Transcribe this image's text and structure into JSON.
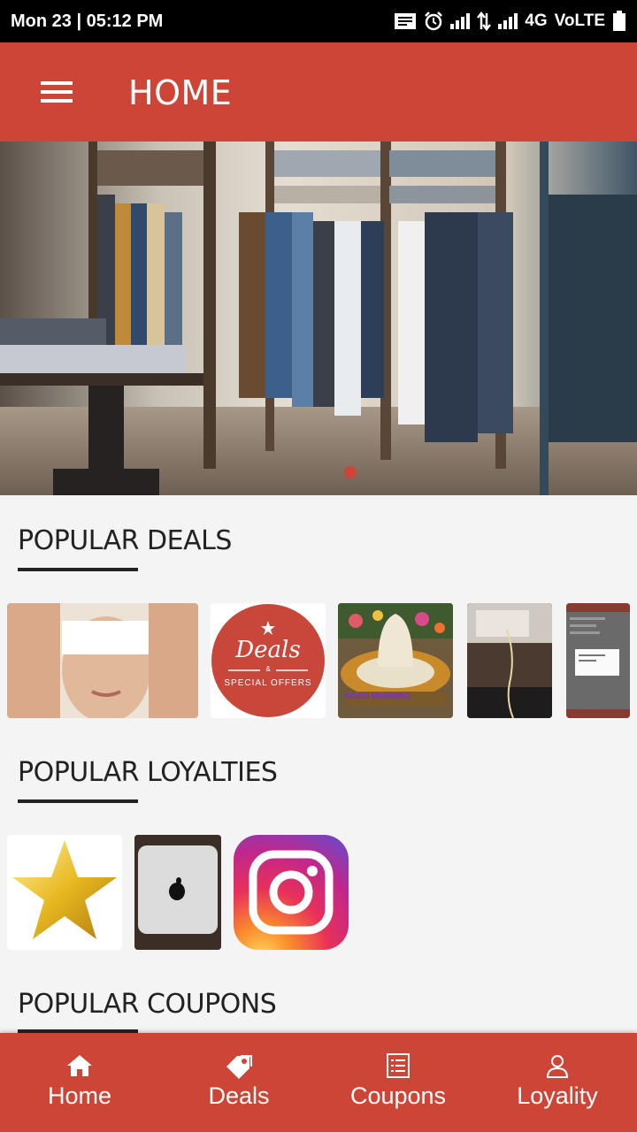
{
  "status_bar": {
    "time": "Mon 23 | 05:12 PM",
    "network": "4G",
    "volte": "VoLTE"
  },
  "app_bar": {
    "title": "HOME",
    "menu_icon": "hamburger-menu-icon"
  },
  "banner": {
    "image": "clothing-store-photo",
    "active_slide_indicator": "red-dot"
  },
  "popular_deals": {
    "title": "POPULAR DEALS",
    "items": [
      {
        "image": "spa-face-massage-photo"
      },
      {
        "image": "deals-special-offers-badge",
        "badge_line1": "Deals",
        "badge_amp": "&",
        "badge_line2": "SPECIAL OFFERS"
      },
      {
        "image": "good-morning-flower-art",
        "caption": "GOOD MORNING"
      },
      {
        "image": "desk-cable-photo"
      },
      {
        "image": "app-screenshot-thumbnail"
      }
    ]
  },
  "popular_loyalties": {
    "title": "POPULAR LOYALTIES",
    "items": [
      {
        "image": "gold-star"
      },
      {
        "image": "mac-mini-photo"
      },
      {
        "image": "instagram-logo"
      }
    ]
  },
  "popular_coupons": {
    "title": "POPULAR COUPONS"
  },
  "bottom_nav": {
    "items": [
      {
        "label": "Home",
        "icon": "home-icon"
      },
      {
        "label": "Deals",
        "icon": "tag-icon"
      },
      {
        "label": "Coupons",
        "icon": "list-icon"
      },
      {
        "label": "Loyality",
        "icon": "person-icon"
      }
    ]
  },
  "colors": {
    "primary": "#cc4536",
    "background": "#f4f4f4",
    "status_bar": "#000000"
  }
}
